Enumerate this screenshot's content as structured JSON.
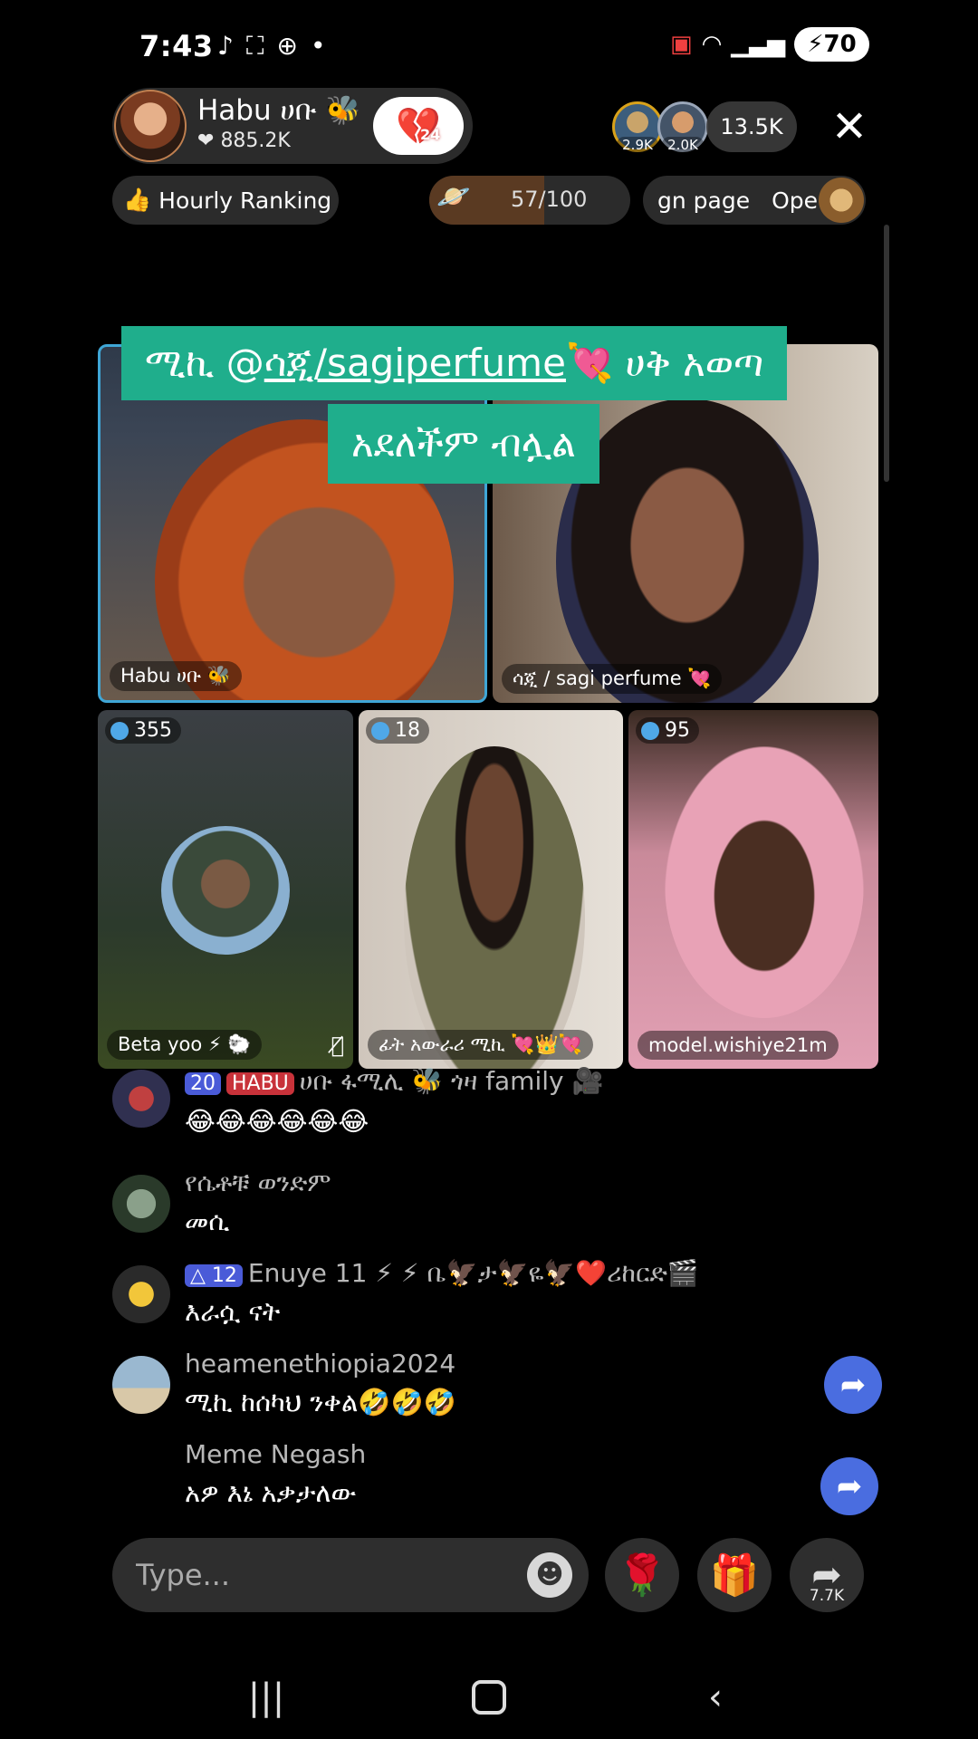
{
  "status_bar": {
    "time": "7:43",
    "battery": "70"
  },
  "host": {
    "name": "Habu ሀቡ 🐝",
    "likes": "885.2K",
    "heart_count": "24"
  },
  "viewers": {
    "top1": "2.9K",
    "top2": "2.0K",
    "count": "13.5K"
  },
  "ranking": {
    "label": "Hourly Ranking"
  },
  "goal": {
    "current": 57,
    "target": 100,
    "text": "57/100"
  },
  "banner": {
    "text1": "gn page",
    "text2": "Ope"
  },
  "caption": {
    "line1_prefix": "ሚኪ @",
    "line1_mention": "ሳጂ/sagiperfume",
    "line1_suffix": "💘 ሀቅ አወጣ",
    "line2": "አደለችም ብሏል"
  },
  "tiles": {
    "host": {
      "label": "Habu ሀቡ 🐝"
    },
    "guest1": {
      "label": "ሳጂ / sagi perfume 💘"
    },
    "guest2": {
      "label": "Beta yoo ⚡ 🐑",
      "badge": "355"
    },
    "guest3": {
      "label": "ፊት አውራሪ ሚኪ 💘👑💘",
      "badge": "18"
    },
    "guest4": {
      "label": "model.wishiye21m",
      "badge": "95"
    }
  },
  "chat": {
    "messages": [
      {
        "badge": "20",
        "tag": "HABU",
        "name": "ሀቡ ፋሚሊ 🐝  ጎዛ family 🎥",
        "text": "😂😂😂😂😂😂"
      },
      {
        "name": "የሴቶቹ ወንድም",
        "text": "መሲ"
      },
      {
        "badge": "12",
        "name": "Enuye  11 ⚡ ⚡ ቤ🦅ታ🦅ዬ🦅❤️ሪከርድ🎬",
        "text": "እራሷ ናት"
      },
      {
        "name": "heamenethiopia2024",
        "text": "ሚኪ ከሰካህ ንቀል🤣🤣🤣"
      },
      {
        "name": "Meme Negash",
        "text": "አዎ እኔ አቃታለው"
      }
    ]
  },
  "input": {
    "placeholder": "Type..."
  },
  "actions": {
    "share_count": "7.7K"
  },
  "colors": {
    "caption_bg": "#1fae8c",
    "share_blue": "#4a6de0",
    "level_badge": "#4a5bd8"
  }
}
